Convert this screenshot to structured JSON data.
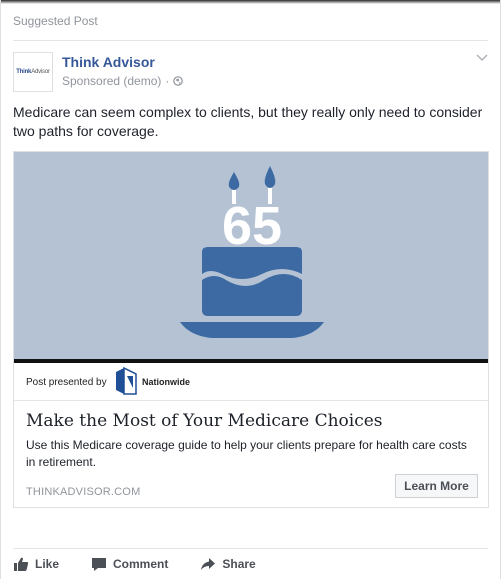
{
  "header": {
    "suggested_label": "Suggested Post"
  },
  "page": {
    "name": "Think Advisor",
    "logo_text_a": "Think",
    "logo_text_b": "Advisor",
    "sponsored": "Sponsored (demo)",
    "separator": "·"
  },
  "post": {
    "text": "Medicare can seem complex to clients, but they really only need to consider two paths for coverage."
  },
  "ad": {
    "image": {
      "cake_number": "65",
      "bg_color": "#b4c2d3",
      "cake_color": "#3d6aa3"
    },
    "presented_label": "Post presented by",
    "sponsor_name": "Nationwide",
    "headline": "Make the Most of Your Medicare Choices",
    "description": "Use this Medicare coverage guide to help your clients prepare for health care costs in retirement.",
    "domain": "THINKADVISOR.COM",
    "cta": "Learn More"
  },
  "actions": {
    "like": "Like",
    "comment": "Comment",
    "share": "Share"
  },
  "colors": {
    "link_blue": "#365899",
    "muted": "#90949c",
    "text": "#1d2129"
  }
}
